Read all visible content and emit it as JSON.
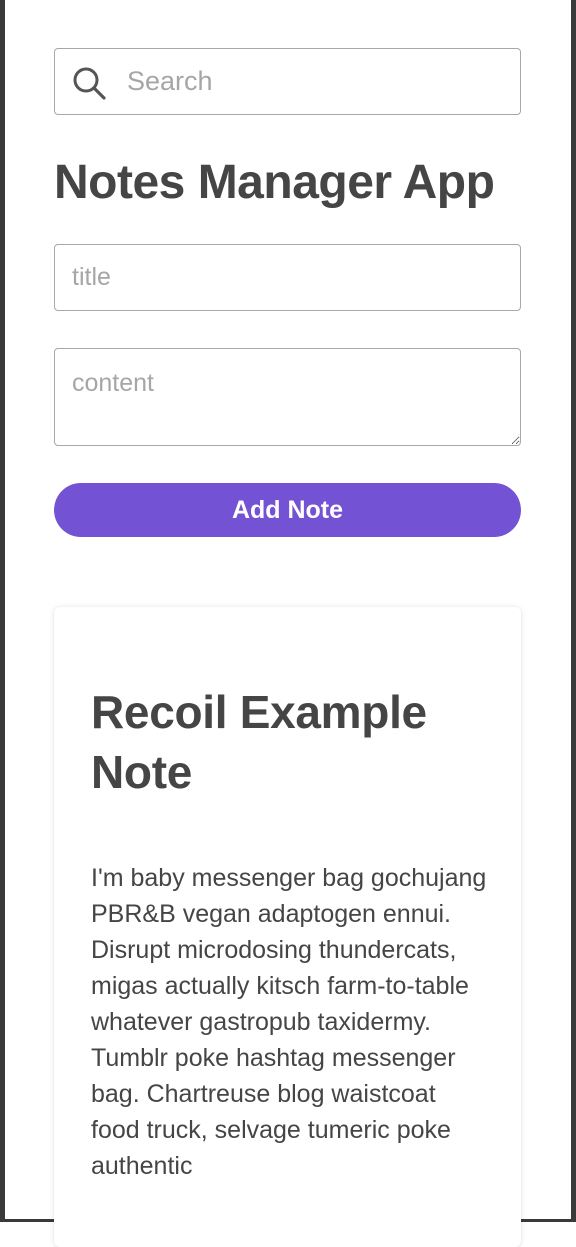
{
  "search": {
    "icon": "search-icon",
    "placeholder": "Search",
    "value": ""
  },
  "header": {
    "title": "Notes Manager App"
  },
  "form": {
    "title_placeholder": "title",
    "title_value": "",
    "content_placeholder": "content",
    "content_value": "",
    "add_label": "Add Note"
  },
  "notes": [
    {
      "title": "Recoil Example Note",
      "content": "I'm baby messenger bag gochujang PBR&B vegan adaptogen ennui. Disrupt microdosing thundercats, migas actually kitsch farm-to-table whatever gastropub taxidermy. Tumblr poke hashtag messenger bag. Chartreuse blog waistcoat food truck, selvage tumeric poke authentic"
    }
  ],
  "colors": {
    "accent": "#7352d4",
    "text": "#454545",
    "placeholder": "#a6a6a6",
    "border": "#a8a8a8"
  }
}
